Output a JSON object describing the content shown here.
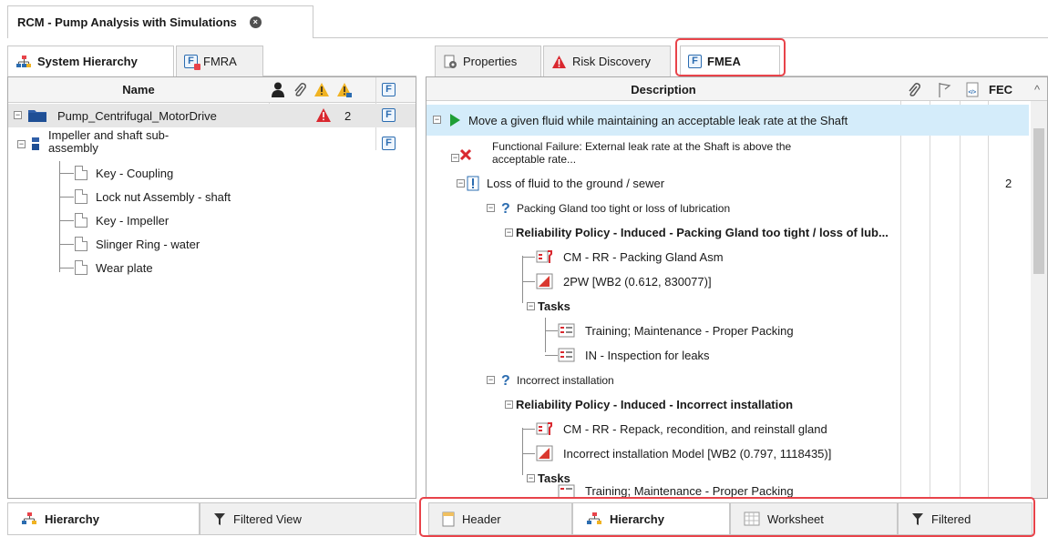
{
  "document_tab": {
    "title": "RCM - Pump Analysis with Simulations",
    "close_symbol": "×"
  },
  "left_tabs": [
    {
      "label": "System Hierarchy",
      "active": true
    },
    {
      "label": "FMRA",
      "active": false
    }
  ],
  "right_tabs": [
    {
      "label": "Properties",
      "active": false
    },
    {
      "label": "Risk Discovery",
      "active": false
    },
    {
      "label": "FMEA",
      "active": true
    }
  ],
  "hierarchy": {
    "header": {
      "name": "Name",
      "f_symbol": "F"
    },
    "rows": [
      {
        "label": "Pump_Centrifugal_MotorDrive",
        "warning_count": "2",
        "f_symbol": "F"
      },
      {
        "label_line1": "Impeller and shaft sub-",
        "label_line2": "assembly",
        "f_symbol": "F"
      },
      {
        "label": "Key - Coupling"
      },
      {
        "label": "Lock nut Assembly - shaft"
      },
      {
        "label": "Key - Impeller"
      },
      {
        "label": "Slinger Ring - water"
      },
      {
        "label": "Wear plate"
      }
    ]
  },
  "fmea": {
    "header": {
      "description": "Description",
      "fec": "FEC"
    },
    "rows": [
      {
        "text": "Move a given fluid while maintaining an acceptable leak rate at the Shaft"
      },
      {
        "text_line1": "Functional Failure: External leak rate at the Shaft is above the",
        "text_line2": "acceptable rate..."
      },
      {
        "text": "Loss of fluid to the ground / sewer",
        "fec": "2"
      },
      {
        "text": "Packing Gland too tight or loss of lubrication"
      },
      {
        "text": "Reliability Policy - Induced - Packing Gland too tight / loss of lub..."
      },
      {
        "text": "CM - RR - Packing Gland Asm"
      },
      {
        "text": "2PW [WB2 (0.612, 830077)]"
      },
      {
        "text": "Tasks"
      },
      {
        "text": "Training; Maintenance - Proper Packing"
      },
      {
        "text": "IN - Inspection for leaks"
      },
      {
        "text": "Incorrect installation"
      },
      {
        "text": "Reliability Policy - Induced - Incorrect installation"
      },
      {
        "text": "CM - RR - Repack, recondition, and reinstall gland"
      },
      {
        "text": "Incorrect installation Model [WB2 (0.797, 1118435)]"
      },
      {
        "text": "Tasks"
      },
      {
        "text": "Training; Maintenance - Proper Packing"
      }
    ]
  },
  "left_bottom_tabs": [
    {
      "label": "Hierarchy",
      "active": true
    },
    {
      "label": "Filtered View",
      "active": false
    }
  ],
  "right_bottom_tabs": [
    {
      "label": "Header",
      "active": false
    },
    {
      "label": "Hierarchy",
      "active": true
    },
    {
      "label": "Worksheet",
      "active": false
    },
    {
      "label": "Filtered",
      "active": false
    }
  ],
  "colors": {
    "highlight_red": "#e8434a",
    "warning_red": "#d9282f",
    "warning_yellow": "#f0b323",
    "accent_blue": "#2b6cb0",
    "selected_row_blue": "#d4ecfa",
    "play_green": "#1e9e35"
  },
  "icons": [
    "hierarchy-icon",
    "fmra-icon",
    "properties-icon",
    "warning-icon",
    "fmea-icon",
    "person-icon",
    "paperclip-icon",
    "flag-icon",
    "code-icon",
    "play-icon",
    "error-x-icon",
    "exclamation-icon",
    "question-icon",
    "wrench-icon",
    "model-icon",
    "task-icon",
    "header-icon",
    "worksheet-icon",
    "filter-icon"
  ]
}
